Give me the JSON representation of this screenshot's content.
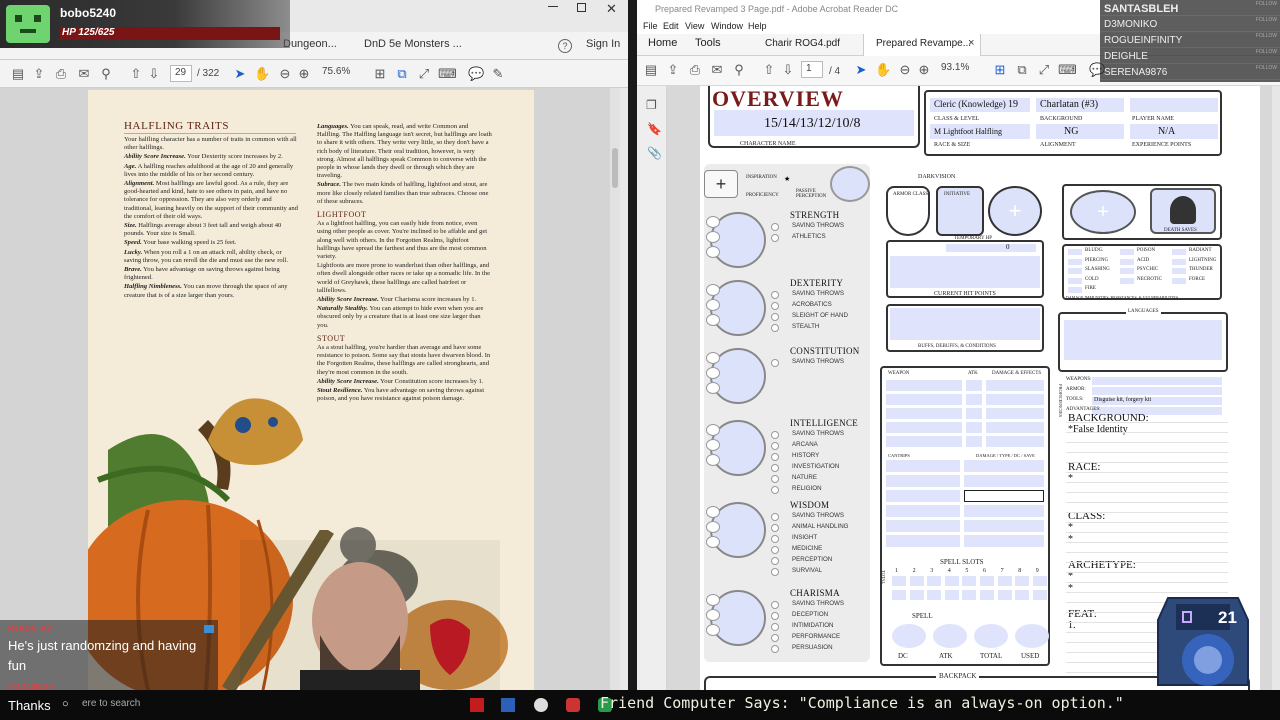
{
  "overlay": {
    "streamer_name": "bobo5240",
    "hp_text": "HP 125/625",
    "followers": [
      "SANTASBLEH",
      "D3MONIKO",
      "ROGUEINFINITY",
      "DEIGHLE",
      "SERENA9876"
    ],
    "follow_tag": "FOLLOW",
    "chat": [
      {
        "user": "RYKON_AV",
        "message": "He's just randomzing and having fun"
      },
      {
        "user": "SANTASBLEH",
        "message": "Thanks"
      }
    ],
    "counter": "21",
    "ticker": "Friend Computer Says: \"Compliance is an always-on option.\""
  },
  "left_window": {
    "tabs": [
      "Dungeon...",
      "DnD 5e Monsters ..."
    ],
    "help_icon": "?",
    "sign_in": "Sign In",
    "page_current": "29",
    "page_total": "/ 322",
    "zoom": "75.6%"
  },
  "phb_page": {
    "heading": "HALFLING TRAITS",
    "col1_intro": "Your halfling character has a number of traits in common with all other halflings.",
    "col1_paras": [
      {
        "b": "Ability Score Increase.",
        "t": " Your Dexterity score increases by 2."
      },
      {
        "b": "Age.",
        "t": " A halfling reaches adulthood at the age of 20 and generally lives into the middle of his or her second century."
      },
      {
        "b": "Alignment.",
        "t": " Most halflings are lawful good. As a rule, they are good-hearted and kind, hate to see others in pain, and have no tolerance for oppression. They are also very orderly and traditional, leaning heavily on the support of their community and the comfort of their old ways."
      },
      {
        "b": "Size.",
        "t": " Halflings average about 3 feet tall and weigh about 40 pounds. Your size is Small."
      },
      {
        "b": "Speed.",
        "t": " Your base walking speed is 25 feet."
      },
      {
        "b": "Lucky.",
        "t": " When you roll a 1 on an attack roll, ability check, or saving throw, you can reroll the die and must use the new roll."
      },
      {
        "b": "Brave.",
        "t": " You have advantage on saving throws against being frightened."
      },
      {
        "b": "Halfling Nimbleness.",
        "t": " You can move through the space of any creature that is of a size larger than yours."
      }
    ],
    "col2_paras": [
      {
        "b": "Languages.",
        "t": " You can speak, read, and write Common and Halfling. The Halfling language isn't secret, but halflings are loath to share it with others. They write very little, so they don't have a rich body of literature. Their oral tradition, however, is very strong. Almost all halflings speak Common to converse with the people in whose lands they dwell or through which they are traveling."
      },
      {
        "b": "Subrace.",
        "t": " The two main kinds of halfling, lightfoot and stout, are more like closely related families than true subraces. Choose one of these subraces."
      }
    ],
    "sub1_head": "LIGHTFOOT",
    "sub1_paras": [
      {
        "b": "",
        "t": "As a lightfoot halfling, you can easily hide from notice, even using other people as cover. You're inclined to be affable and get along well with others. In the Forgotten Realms, lightfoot halflings have spread the farthest and thus are the most common variety."
      },
      {
        "b": "",
        "t": "Lightfoots are more prone to wanderlust than other halflings, and often dwell alongside other races or take up a nomadic life. In the world of Greyhawk, these halflings are called hairfeet or tallfellows."
      },
      {
        "b": "Ability Score Increase.",
        "t": " Your Charisma score increases by 1."
      },
      {
        "b": "Naturally Stealthy.",
        "t": " You can attempt to hide even when you are obscured only by a creature that is at least one size larger than you."
      }
    ],
    "sub2_head": "STOUT",
    "sub2_paras": [
      {
        "b": "",
        "t": "As a stout halfling, you're hardier than average and have some resistance to poison. Some say that stouts have dwarven blood. In the Forgotten Realms, these halflings are called stronghearts, and they're most common in the south."
      },
      {
        "b": "Ability Score Increase.",
        "t": " Your Constitution score increases by 1."
      },
      {
        "b": "Stout Resilience.",
        "t": " You have advantage on saving throws against poison, and you have resistance against poison damage."
      }
    ]
  },
  "right_window": {
    "title": "Prepared Revamped 3 Page.pdf - Adobe Acrobat Reader DC",
    "menu": [
      "File",
      "Edit",
      "View",
      "Window",
      "Help"
    ],
    "tabs": [
      "Home",
      "Tools",
      "Charir ROG4.pdf",
      "Prepared Revampe..."
    ],
    "tab_close": "×",
    "page_current": "1",
    "page_total": "/ 4",
    "zoom": "93.1%"
  },
  "sheet": {
    "title": "OVERVIEW",
    "character_name": "15/14/13/12/10/8",
    "character_name_lbl": "CHARACTER NAME",
    "class_level": "Cleric (Knowledge)",
    "level_num": "19",
    "background": "Charlatan (#3)",
    "class_level_lbl": "CLASS & LEVEL",
    "background_lbl": "BACKGROUND",
    "player_name_lbl": "PLAYER NAME",
    "race": "M Lightfoot Halfling",
    "alignment": "NG",
    "xp": "N/A",
    "race_lbl": "RACE & SIZE",
    "alignment_lbl": "ALIGNMENT",
    "xp_lbl": "EXPERIENCE POINTS",
    "inspiration_lbl": "INSPIRATION",
    "proficiency_lbl": "PROFICIENCY",
    "passive_lbl": "PASSIVE PERCEPTION",
    "darkvision_lbl": "DARKVISION",
    "ac_lbl": "ARMOR CLASS",
    "initiative_lbl": "INITIATIVE",
    "temp_hp_lbl": "TEMPORARY HP",
    "temp_hp": "0",
    "current_hp_lbl": "CURRENT HIT POINTS",
    "buffs_lbl": "BUFFS, DEBUFFS, & CONDITIONS",
    "death_saves_lbl": "DEATH SAVES",
    "damage_types": [
      "BLUDG.",
      "POISON",
      "RADIANT",
      "PIERCING",
      "ACID",
      "LIGHTNING",
      "SLASHING",
      "PSYCHIC",
      "THUNDER",
      "COLD",
      "NECROTIC",
      "FORCE",
      "FIRE"
    ],
    "damage_footer": "DAMAGE IMMUNITIES, RESISTANCES, & VULNERABILITIES",
    "languages_lbl": "LANGUAGES",
    "prof_rows": [
      "WEAPONS:",
      "ARMOR:",
      "TOOLS:",
      "ADVANTAGES:"
    ],
    "tools_value": "Disguise kit, forgery kit",
    "proficiencies_side": "PROFICIENCIES",
    "weapon_hdr": [
      "WEAPON",
      "ATK",
      "DAMAGE & EFFECTS"
    ],
    "cantrip_hdr": [
      "CANTRIPS",
      "DAMAGE / TYPE / DC / SAVE"
    ],
    "spell_slots_lbl": "SPELL SLOTS",
    "spell_levels": [
      "1",
      "2",
      "3",
      "4",
      "5",
      "6",
      "7",
      "8",
      "9"
    ],
    "total_lbl": "TOTAL",
    "spell_lbl": "SPELL",
    "spell_footer": [
      "DC",
      "ATK",
      "TOTAL",
      "USED"
    ],
    "backpack_lbl": "BACKPACK",
    "stats": [
      {
        "name": "STRENGTH",
        "skills": [
          "SAVING THROWS",
          "ATHLETICS"
        ]
      },
      {
        "name": "DEXTERITY",
        "skills": [
          "SAVING THROWS",
          "ACROBATICS",
          "SLEIGHT OF HAND",
          "STEALTH"
        ]
      },
      {
        "name": "CONSTITUTION",
        "skills": [
          "SAVING THROWS"
        ]
      },
      {
        "name": "INTELLIGENCE",
        "skills": [
          "SAVING THROWS",
          "ARCANA",
          "HISTORY",
          "INVESTIGATION",
          "NATURE",
          "RELIGION"
        ]
      },
      {
        "name": "WISDOM",
        "skills": [
          "SAVING THROWS",
          "ANIMAL HANDLING",
          "INSIGHT",
          "MEDICINE",
          "PERCEPTION",
          "SURVIVAL"
        ]
      },
      {
        "name": "CHARISMA",
        "skills": [
          "SAVING THROWS",
          "DECEPTION",
          "INTIMIDATION",
          "PERFORMANCE",
          "PERSUASION"
        ]
      }
    ],
    "notes": [
      {
        "head": "BACKGROUND:",
        "lines": [
          "*False Identity"
        ]
      },
      {
        "head": "RACE:",
        "lines": [
          "*"
        ]
      },
      {
        "head": "CLASS:",
        "lines": [
          "*",
          "*"
        ]
      },
      {
        "head": "ARCHETYPE:",
        "lines": [
          "*",
          "*"
        ]
      },
      {
        "head": "FEAT:",
        "lines": [
          "1."
        ]
      }
    ]
  },
  "taskbar": {
    "search_placeholder": "ere to search"
  }
}
